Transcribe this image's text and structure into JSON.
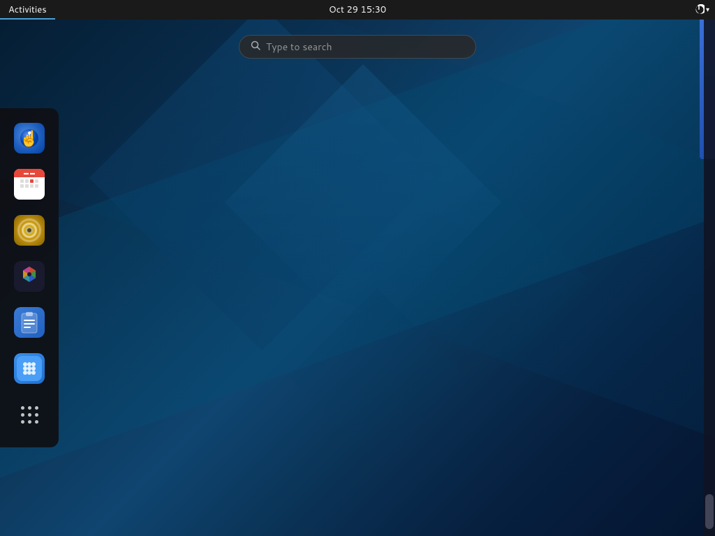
{
  "topbar": {
    "activities_label": "Activities",
    "clock": "Oct 29  15:30",
    "power_title": "Power Off / Log Out"
  },
  "search": {
    "placeholder": "Type to search"
  },
  "dock": {
    "items": [
      {
        "id": "gesture",
        "name": "Gesture",
        "tooltip": "Gesture"
      },
      {
        "id": "calendar",
        "name": "Calendar",
        "tooltip": "Calendar"
      },
      {
        "id": "speaker",
        "name": "Speaker",
        "tooltip": "Rhythmbox"
      },
      {
        "id": "prism",
        "name": "Prism Color Picker",
        "tooltip": "Prism Color Picker"
      },
      {
        "id": "clipboard",
        "name": "Clipboard Manager",
        "tooltip": "Clipboard Manager"
      },
      {
        "id": "appstore",
        "name": "App Store",
        "tooltip": "GNOME Software"
      },
      {
        "id": "apps-grid",
        "name": "Show Applications",
        "tooltip": "Show Applications"
      }
    ]
  }
}
